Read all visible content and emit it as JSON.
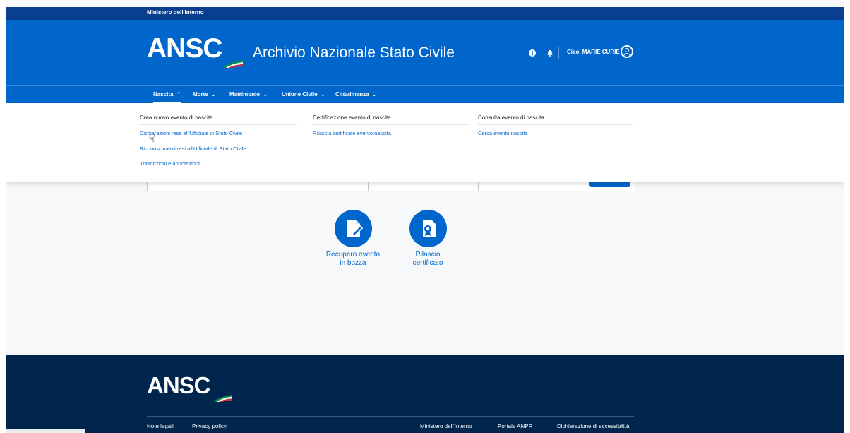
{
  "top_bar": {
    "ministry": "Ministero dell'Interno"
  },
  "header": {
    "logo": "ANSC",
    "app_title": "Archivio Nazionale Stato Civile",
    "greeting": "Ciao, MARIE CURIE"
  },
  "nav": {
    "items": [
      {
        "label": "Nascita",
        "chevron": "^"
      },
      {
        "label": "Morte",
        "chevron": "v"
      },
      {
        "label": "Matrimonio",
        "chevron": "v"
      },
      {
        "label": "Unione Civile",
        "chevron": "v"
      },
      {
        "label": "Cittadinanza",
        "chevron": "v"
      }
    ]
  },
  "megamenu": {
    "columns": [
      {
        "heading": "Crea nuovo evento di nascita",
        "links": [
          "Dichiarazioni rese all'Ufficiale di Stato Civile",
          "Riconoscimenti resi all'Ufficiale di Stato Civile",
          "Trascrizioni e annotazioni"
        ]
      },
      {
        "heading": "Certificazione evento di nascita",
        "links": [
          "Rilascia certificato evento nascita"
        ]
      },
      {
        "heading": "Consulta evento di nascita",
        "links": [
          "Cerca evento nascita"
        ]
      }
    ]
  },
  "quick_actions": [
    {
      "line1": "Recupero evento",
      "line2": "in bozza",
      "icon": "document-edit-icon"
    },
    {
      "line1": "Rilascio",
      "line2": "certificato",
      "icon": "certificate-icon"
    }
  ],
  "footer": {
    "logo": "ANSC",
    "links": [
      "Note legali",
      "Privacy policy",
      "Ministero dell'Interno",
      "Portale ANPR",
      "Dichiarazione di accessibilità"
    ]
  },
  "colors": {
    "primary": "#0066cc",
    "footer": "#00264d",
    "slim": "#0a3f8f"
  }
}
